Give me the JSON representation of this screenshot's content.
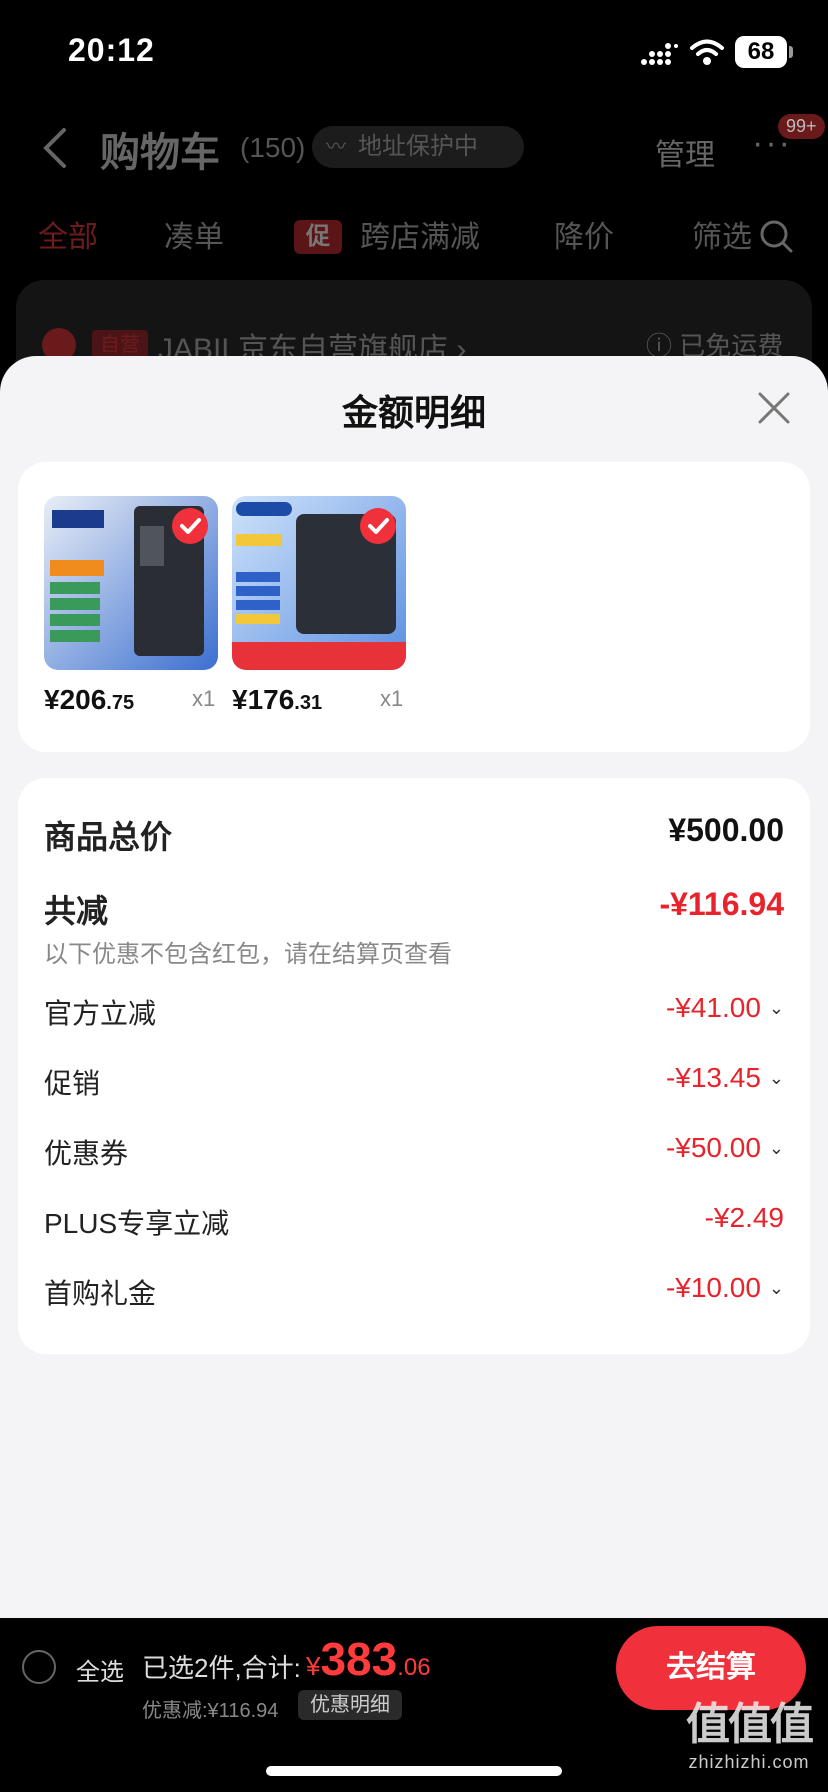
{
  "status_bar": {
    "time": "20:12",
    "battery": "68"
  },
  "background": {
    "title": "购物车",
    "count": "(150)",
    "address_pill": "地址保护中",
    "manage": "管理",
    "more": "···",
    "badge": "99+",
    "tabs": [
      "全部",
      "凑单",
      "跨店满减",
      "降价",
      "筛选"
    ],
    "promo_tag": "促",
    "store": {
      "self_tag": "自营",
      "name": "JABIL京东自营旗舰店 ›",
      "shipping": "ⓘ 已免运费"
    }
  },
  "sheet": {
    "title": "金额明细",
    "products": [
      {
        "price_int": "¥206",
        "price_dec": ".75",
        "qty": "x1"
      },
      {
        "price_int": "¥176",
        "price_dec": ".31",
        "qty": "x1"
      }
    ],
    "total_label": "商品总价",
    "total_value": "¥500.00",
    "reduce_label": "共减",
    "reduce_value": "-¥116.94",
    "reduce_note": "以下优惠不包含红包，请在结算页查看",
    "discounts": [
      {
        "label": "官方立减",
        "value": "-¥41.00"
      },
      {
        "label": "促销",
        "value": "-¥13.45"
      },
      {
        "label": "优惠券",
        "value": "-¥50.00"
      },
      {
        "label": "PLUS专享立减",
        "value": "-¥2.49"
      },
      {
        "label": "首购礼金",
        "value": "-¥10.00"
      }
    ]
  },
  "bottom_bar": {
    "select_all": "全选",
    "selected_text": "已选2件,合计:",
    "total_yen": "¥",
    "total_int": "383",
    "total_dec": ".06",
    "discount_text": "优惠减:¥116.94",
    "detail_pill": "优惠明细",
    "checkout": "去结算"
  },
  "watermark": {
    "main": "值值值",
    "sub": "zhizhizhi.com"
  },
  "colors": {
    "accent": "#f0303a",
    "discount_red": "#e8232c",
    "sheet_bg": "#f4f4f6"
  }
}
